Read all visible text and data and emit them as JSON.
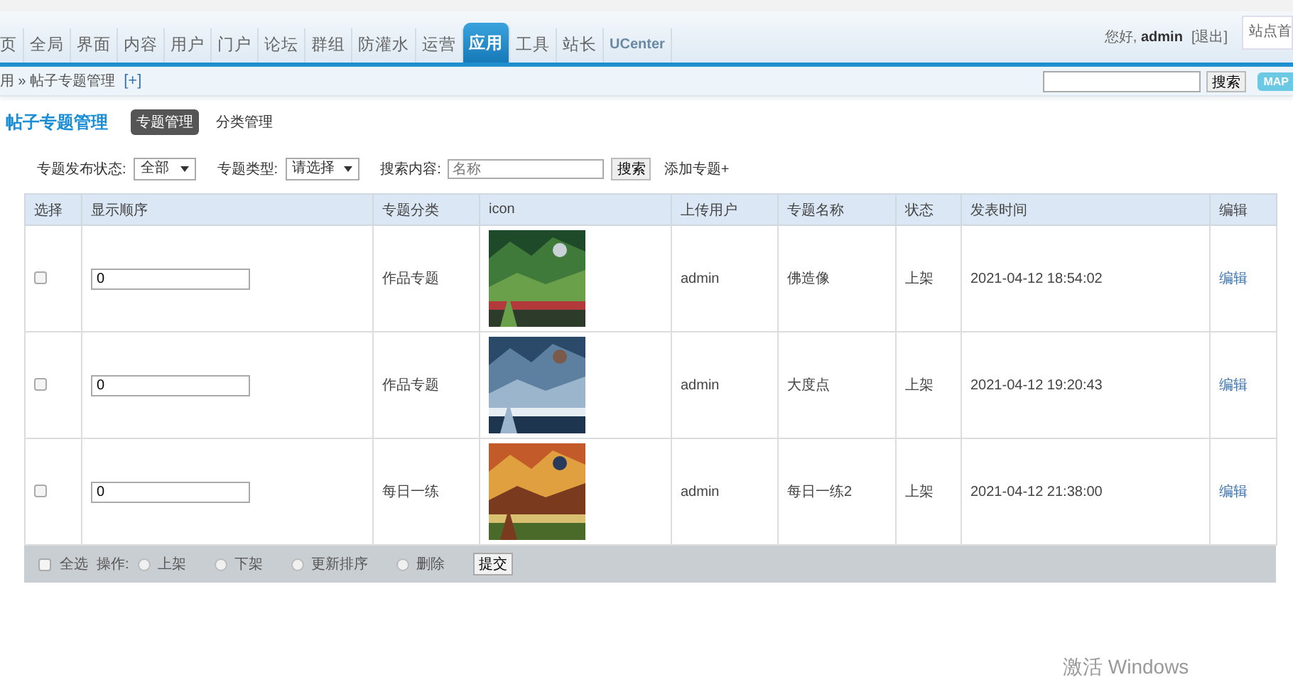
{
  "nav": {
    "tabs": [
      {
        "label": "页",
        "selected": false
      },
      {
        "label": "全局",
        "selected": false
      },
      {
        "label": "界面",
        "selected": false
      },
      {
        "label": "内容",
        "selected": false
      },
      {
        "label": "用户",
        "selected": false
      },
      {
        "label": "门户",
        "selected": false
      },
      {
        "label": "论坛",
        "selected": false
      },
      {
        "label": "群组",
        "selected": false
      },
      {
        "label": "防灌水",
        "selected": false
      },
      {
        "label": "运营",
        "selected": false
      },
      {
        "label": "应用",
        "selected": true
      },
      {
        "label": "工具",
        "selected": false
      },
      {
        "label": "站长",
        "selected": false
      },
      {
        "label": "UCenter",
        "selected": false
      }
    ],
    "greeting": "您好,",
    "user": "admin",
    "logout": "[退出]",
    "site_home": "站点首"
  },
  "breadcrumb": {
    "path": "用 » 帖子专题管理",
    "add": "[+]",
    "search_button": "搜索",
    "map_button": "MAP"
  },
  "panel": {
    "title": "帖子专题管理",
    "subtabs": [
      {
        "label": "专题管理",
        "selected": true
      },
      {
        "label": "分类管理",
        "selected": false
      }
    ]
  },
  "filter": {
    "status_label": "专题发布状态:",
    "status_value": "全部",
    "type_label": "专题类型:",
    "type_value": "请选择",
    "search_label": "搜索内容:",
    "search_placeholder": "名称",
    "search_button": "搜索",
    "add_link": "添加专题+"
  },
  "table": {
    "columns": [
      "选择",
      "显示顺序",
      "专题分类",
      "icon",
      "上传用户",
      "专题名称",
      "状态",
      "发表时间",
      "编辑"
    ],
    "rows": [
      {
        "checked": false,
        "order": "0",
        "category": "作品专题",
        "user": "admin",
        "name": "佛造像",
        "status": "上架",
        "time": "2021-04-12 18:54:02",
        "edit": "编辑"
      },
      {
        "checked": false,
        "order": "0",
        "category": "作品专题",
        "user": "admin",
        "name": "大度点",
        "status": "上架",
        "time": "2021-04-12 19:20:43",
        "edit": "编辑"
      },
      {
        "checked": false,
        "order": "0",
        "category": "每日一练",
        "user": "admin",
        "name": "每日一练2",
        "status": "上架",
        "time": "2021-04-12 21:38:00",
        "edit": "编辑"
      }
    ]
  },
  "footer": {
    "select_all": {
      "label": "全选",
      "checked": false
    },
    "action_label": "操作:",
    "actions": [
      {
        "label": "上架",
        "selected": false
      },
      {
        "label": "下架",
        "selected": false
      },
      {
        "label": "更新排序",
        "selected": false
      },
      {
        "label": "删除",
        "selected": false
      }
    ],
    "submit": "提交"
  },
  "os_notice": "激活 Windows"
}
